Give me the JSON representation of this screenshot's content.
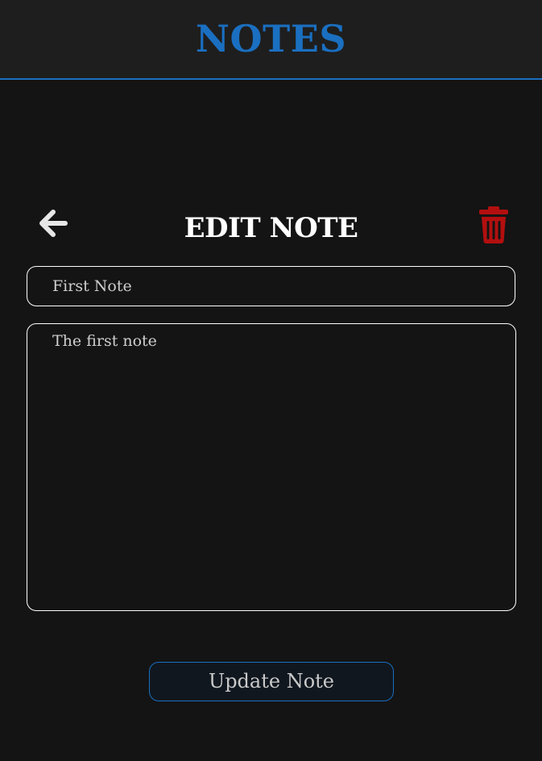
{
  "app": {
    "title": "NOTES",
    "accent_color": "#1a6fc0",
    "background_color": "#141414",
    "header_color": "#1e1e1e"
  },
  "edit": {
    "heading": "EDIT NOTE",
    "back_icon": "arrow-left-icon",
    "delete_icon": "trash-icon",
    "delete_color": "#b30f0f"
  },
  "note": {
    "title_value": "First Note",
    "body_value": "The first note"
  },
  "actions": {
    "update_label": "Update Note"
  }
}
